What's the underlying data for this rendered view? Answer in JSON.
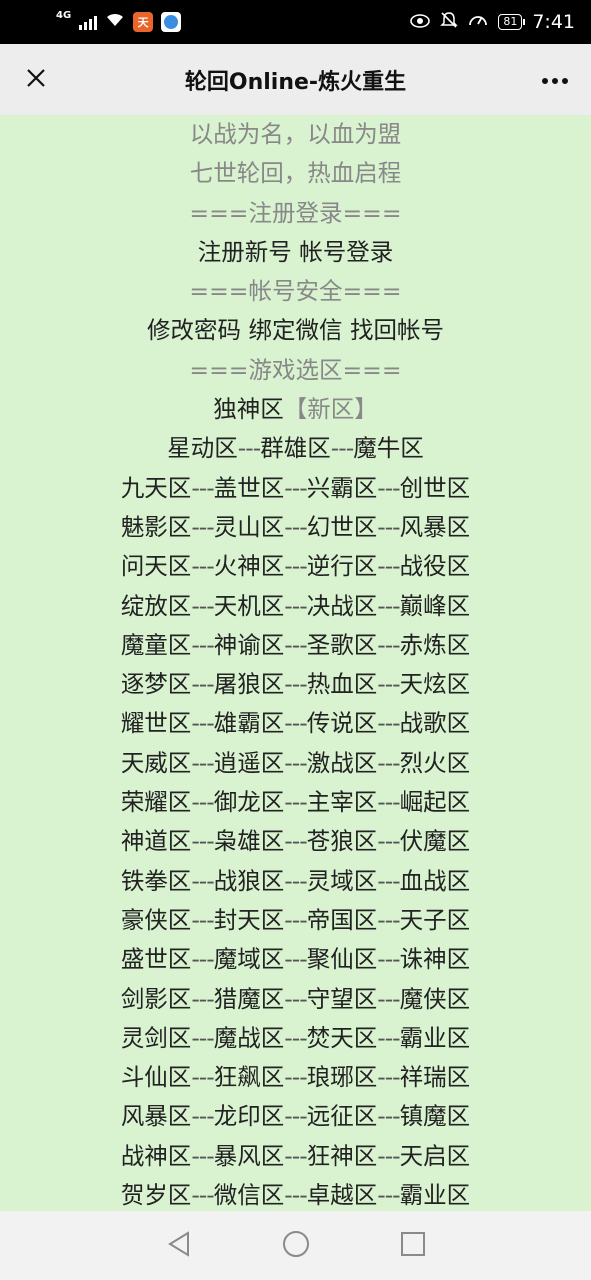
{
  "status_bar": {
    "network": "4G",
    "app_icon_1": "天",
    "battery": "81",
    "time": "7:41"
  },
  "header": {
    "title": "轮回Online-炼火重生",
    "close_icon": "close-icon",
    "more_icon": "more-icon"
  },
  "content": {
    "slogan1": "以战为名，以血为盟",
    "slogan2": "七世轮回，热血启程",
    "section_register": "===注册登录===",
    "register_link": "注册新号",
    "login_link": "帐号登录",
    "section_security": "===帐号安全===",
    "change_pwd_link": "修改密码",
    "bind_wechat_link": "绑定微信",
    "recover_link": "找回帐号",
    "section_server": "===游戏选区===",
    "featured_server": "独神区",
    "featured_tag": "【新区】",
    "separator": "---",
    "server_rows": [
      [
        "星动区",
        "群雄区",
        "魔牛区"
      ],
      [
        "九天区",
        "盖世区",
        "兴霸区",
        "创世区"
      ],
      [
        "魅影区",
        "灵山区",
        "幻世区",
        "风暴区"
      ],
      [
        "问天区",
        "火神区",
        "逆行区",
        "战役区"
      ],
      [
        "绽放区",
        "天机区",
        "决战区",
        "巅峰区"
      ],
      [
        "魔童区",
        "神谕区",
        "圣歌区",
        "赤炼区"
      ],
      [
        "逐梦区",
        "屠狼区",
        "热血区",
        "天炫区"
      ],
      [
        "耀世区",
        "雄霸区",
        "传说区",
        "战歌区"
      ],
      [
        "天威区",
        "逍遥区",
        "激战区",
        "烈火区"
      ],
      [
        "荣耀区",
        "御龙区",
        "主宰区",
        "崛起区"
      ],
      [
        "神道区",
        "枭雄区",
        "苍狼区",
        "伏魔区"
      ],
      [
        "铁拳区",
        "战狼区",
        "灵域区",
        "血战区"
      ],
      [
        "豪侠区",
        "封天区",
        "帝国区",
        "天子区"
      ],
      [
        "盛世区",
        "魔域区",
        "聚仙区",
        "诛神区"
      ],
      [
        "剑影区",
        "猎魔区",
        "守望区",
        "魔侠区"
      ],
      [
        "灵剑区",
        "魔战区",
        "焚天区",
        "霸业区"
      ],
      [
        "斗仙区",
        "狂飙区",
        "琅琊区",
        "祥瑞区"
      ],
      [
        "风暴区",
        "龙印区",
        "远征区",
        "镇魔区"
      ],
      [
        "战神区",
        "暴风区",
        "狂神区",
        "天启区"
      ],
      [
        "贺岁区",
        "微信区",
        "卓越区",
        "霸业区"
      ]
    ]
  },
  "nav_bar": {
    "back_icon": "back-triangle-icon",
    "home_icon": "home-circle-icon",
    "recents_icon": "recents-square-icon"
  }
}
